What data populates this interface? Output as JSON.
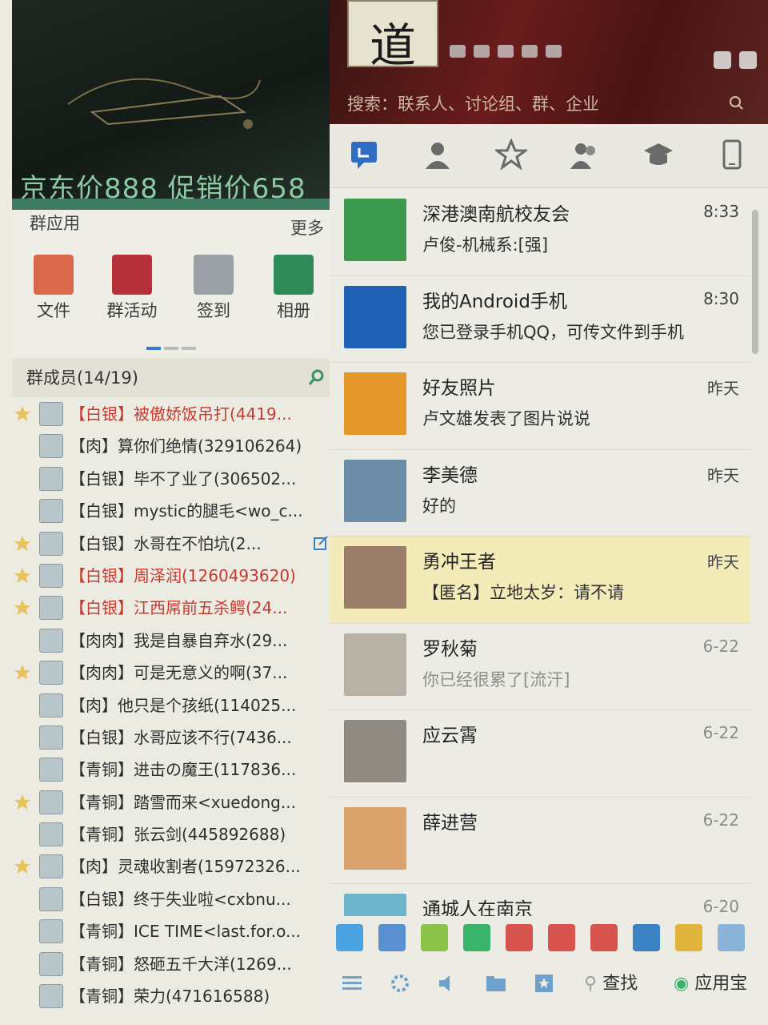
{
  "left": {
    "ad_text": "京东价888 促销价658",
    "group_apps_title": "群应用",
    "group_apps_more": "更多",
    "apps": [
      {
        "label": "文件",
        "color": "#d9694a"
      },
      {
        "label": "群活动",
        "color": "#b5303a"
      },
      {
        "label": "签到",
        "color": "#9aa0a6"
      },
      {
        "label": "相册",
        "color": "#2f8a5a"
      }
    ],
    "members_title": "群成员(14/19)",
    "members": [
      {
        "text": "【白银】被傲娇饭吊打(4419...",
        "red": true
      },
      {
        "text": "【肉】算你们绝情(329106264)",
        "red": false
      },
      {
        "text": "【白银】毕不了业了(306502...",
        "red": false
      },
      {
        "text": "【白银】mystic的腿毛<wo_c...",
        "red": false
      },
      {
        "text": "【白银】水哥在不怕坑(2...",
        "red": false
      },
      {
        "text": "【白银】周泽润(1260493620)",
        "red": true
      },
      {
        "text": "【白银】江西屌前五杀鳄(24...",
        "red": true
      },
      {
        "text": "【肉肉】我是自暴自弃水(29...",
        "red": false
      },
      {
        "text": "【肉肉】可是无意义的啊(37...",
        "red": false
      },
      {
        "text": "【肉】他只是个孩纸(114025...",
        "red": false
      },
      {
        "text": "【白银】水哥应该不行(7436...",
        "red": false
      },
      {
        "text": "【青铜】进击の魔王(117836...",
        "red": false
      },
      {
        "text": "【青铜】踏雪而来<xuedong...",
        "red": false
      },
      {
        "text": "【青铜】张云剑(445892688)",
        "red": false
      },
      {
        "text": "【肉】灵魂收割者(15972326...",
        "red": false
      },
      {
        "text": "【白银】终于失业啦<cxbnu...",
        "red": false
      },
      {
        "text": "【青铜】ICE TIME<last.for.o...",
        "red": false
      },
      {
        "text": "【青铜】怒砸五千大洋(1269...",
        "red": false
      },
      {
        "text": "【青铜】荣力(471616588)",
        "red": false
      }
    ]
  },
  "right": {
    "user_avatar_char": "道",
    "search_placeholder": "搜索：联系人、讨论组、群、企业",
    "conversations": [
      {
        "name": "深港澳南航校友会",
        "message": "卢俊-机械系:[强]",
        "time": "8:33",
        "avatar_color": "#3b9a4e",
        "gray_time": false,
        "gray_msg": false
      },
      {
        "name": "我的Android手机",
        "message": "您已登录手机QQ，可传文件到手机",
        "time": "8:30",
        "avatar_color": "#1f5fb4",
        "gray_time": false,
        "gray_msg": false
      },
      {
        "name": "好友照片",
        "message": "卢文雄发表了图片说说",
        "time": "昨天",
        "avatar_color": "#e5962a",
        "gray_time": false,
        "gray_msg": false
      },
      {
        "name": "李美德",
        "message": "好的",
        "time": "昨天",
        "avatar_color": "#6d8ca8",
        "gray_time": false,
        "gray_msg": false
      },
      {
        "name": "勇冲王者",
        "message": "【匿名】立地太岁：请不请",
        "time": "昨天",
        "avatar_color": "#9a7e6a",
        "gray_time": false,
        "gray_msg": false
      },
      {
        "name": "罗秋菊",
        "message": "你已经很累了[流汗]",
        "time": "6-22",
        "avatar_color": "#b7b1a6",
        "gray_time": true,
        "gray_msg": true
      },
      {
        "name": "应云霄",
        "message": "",
        "time": "6-22",
        "avatar_color": "#8f8a82",
        "gray_time": true,
        "gray_msg": true
      },
      {
        "name": "薛进营",
        "message": "",
        "time": "6-22",
        "avatar_color": "#d9a36b",
        "gray_time": true,
        "gray_msg": true
      },
      {
        "name": "通城人在南京",
        "message": "",
        "time": "6-20",
        "avatar_color": "#6db3c9",
        "gray_time": true,
        "gray_msg": true
      }
    ],
    "toolbar_find": "查找",
    "toolbar_appstore": "应用宝",
    "toolbar_icons": [
      "#4aa3e0",
      "#5a8fd0",
      "#8bc34a",
      "#3ab36b",
      "#d9534f",
      "#d9534f",
      "#d9534f",
      "#3b82c4",
      "#e0b43a",
      "#8ab4d8"
    ]
  }
}
